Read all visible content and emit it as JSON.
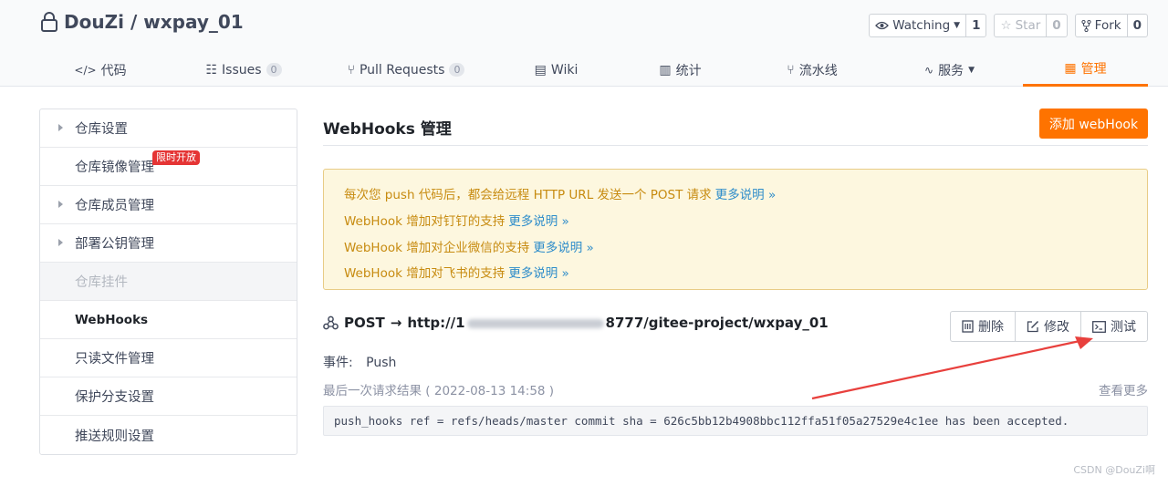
{
  "repo": {
    "owner": "DouZi",
    "separator": "/",
    "name": "wxpay_01",
    "icon": "lock-icon"
  },
  "repo_actions": {
    "watch": {
      "label": "Watching",
      "count": "1"
    },
    "star": {
      "label": "Star",
      "count": "0"
    },
    "fork": {
      "label": "Fork",
      "count": "0"
    }
  },
  "tabs": [
    {
      "label": "代码",
      "icon": "code-icon"
    },
    {
      "label": "Issues",
      "badge": "0",
      "icon": "issues-icon"
    },
    {
      "label": "Pull Requests",
      "badge": "0",
      "icon": "pull-request-icon"
    },
    {
      "label": "Wiki",
      "icon": "wiki-icon"
    },
    {
      "label": "统计",
      "icon": "chart-icon"
    },
    {
      "label": "流水线",
      "icon": "pipeline-icon"
    },
    {
      "label": "服务",
      "icon": "pulse-icon"
    },
    {
      "label": "管理",
      "icon": "manage-icon",
      "active": true
    }
  ],
  "sidebar": {
    "items": [
      {
        "label": "仓库设置"
      },
      {
        "label": "仓库镜像管理",
        "badge": "限时开放"
      },
      {
        "label": "仓库成员管理"
      },
      {
        "label": "部署公钥管理"
      },
      {
        "label": "仓库挂件"
      },
      {
        "label": "WebHooks"
      },
      {
        "label": "只读文件管理"
      },
      {
        "label": "保护分支设置"
      },
      {
        "label": "推送规则设置"
      }
    ]
  },
  "main": {
    "title": "WebHooks 管理",
    "add_button": "添加 webHook",
    "notice": [
      {
        "text": "每次您 push 代码后，都会给远程 HTTP URL 发送一个 POST 请求",
        "link": "更多说明 »"
      },
      {
        "text": "WebHook 增加对钉钉的支持",
        "link": "更多说明 »"
      },
      {
        "text": "WebHook 增加对企业微信的支持",
        "link": "更多说明 »"
      },
      {
        "text": "WebHook 增加对飞书的支持",
        "link": "更多说明 »"
      }
    ],
    "hook": {
      "method": "POST",
      "arrow": "→",
      "url_prefix": "http://1",
      "url_suffix": "8777/gitee-project/wxpay_01",
      "actions": {
        "delete": "删除",
        "edit": "修改",
        "test": "测试"
      },
      "event_label": "事件:",
      "event_value": "Push",
      "last_result": "最后一次请求结果 ( 2022-08-13 14:58 )",
      "more": "查看更多",
      "log": "push_hooks ref = refs/heads/master commit sha = 626c5bb12b4908bbc112ffa51f05a27529e4c1ee has been accepted."
    }
  },
  "watermark": "CSDN @DouZi啊",
  "colors": {
    "accent": "#fe7300",
    "link": "#2d8cca",
    "notice_text": "#c78b10",
    "annotation_arrow": "#e8403d"
  }
}
